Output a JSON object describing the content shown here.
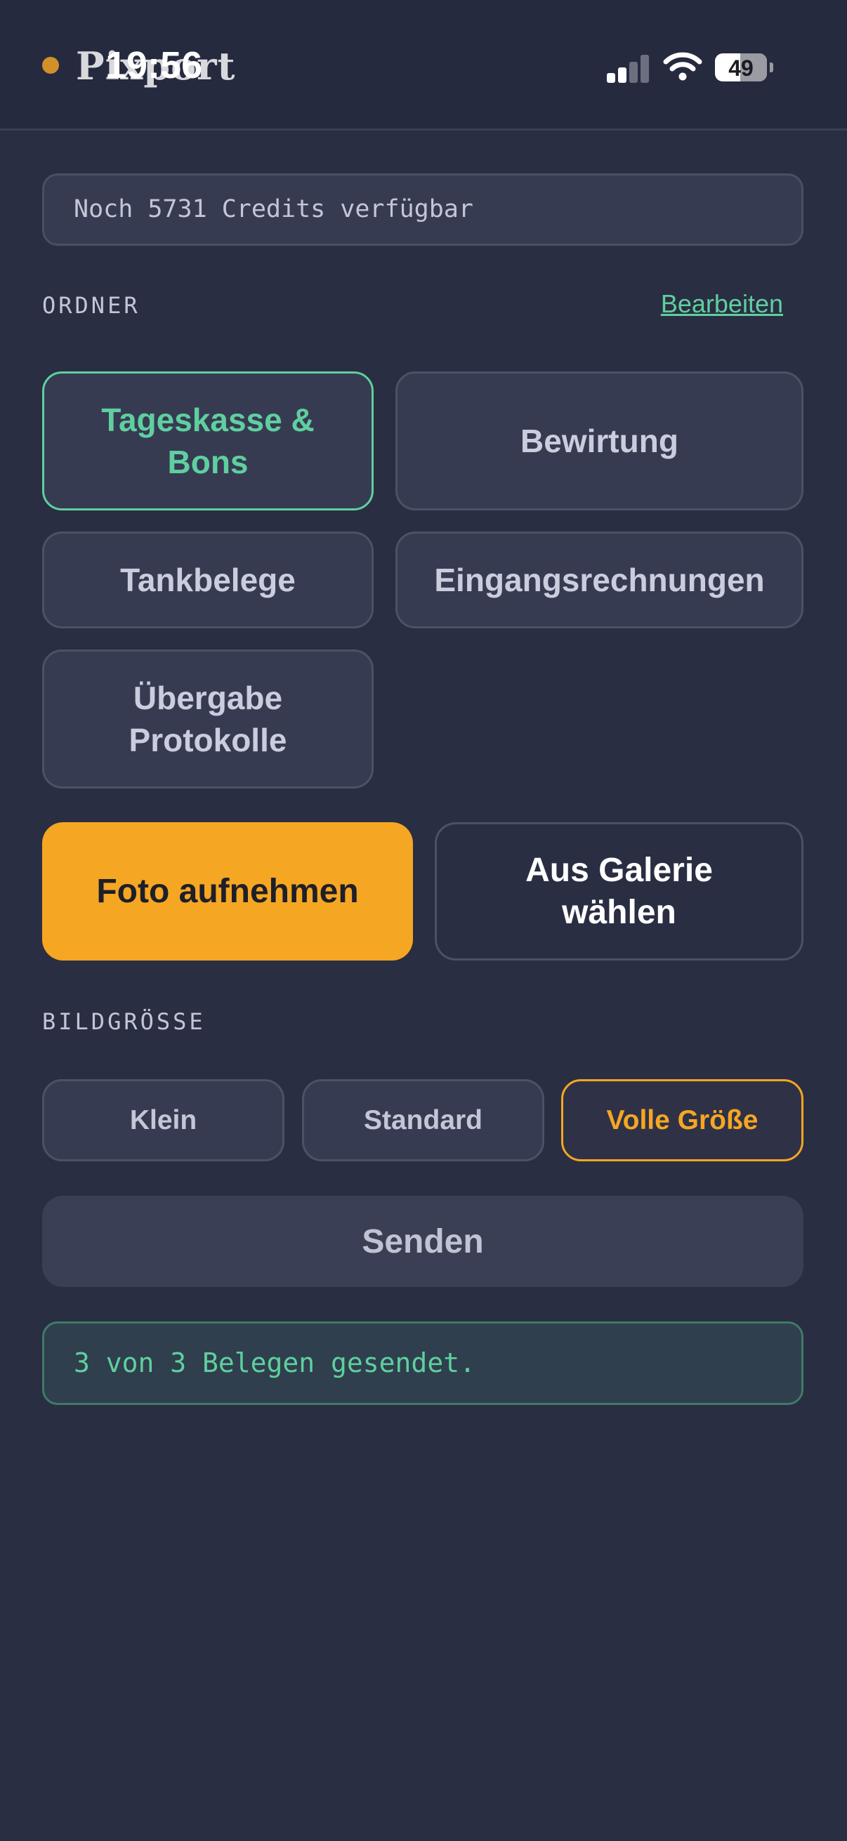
{
  "status_bar": {
    "time": "19:56",
    "battery": "49",
    "battery_level": 0.49,
    "signal_bars": 2
  },
  "header": {
    "app_name": "Pixport"
  },
  "credits": {
    "text": "Noch 5731 Credits verfügbar"
  },
  "folders": {
    "label": "ORDNER",
    "edit_label": "Bearbeiten",
    "items": [
      {
        "label": "Tageskasse & Bons",
        "active": true
      },
      {
        "label": "Bewirtung",
        "active": false
      },
      {
        "label": "Tankbelege",
        "active": false
      },
      {
        "label": "Eingangsrechnungen",
        "active": false
      },
      {
        "label": "Übergabe Protokolle",
        "active": false
      }
    ]
  },
  "actions": {
    "camera_label": "Foto aufnehmen",
    "gallery_label": "Aus Galerie wählen"
  },
  "image_size": {
    "label": "BILDGRÖSSE",
    "options": [
      {
        "label": "Klein",
        "active": false
      },
      {
        "label": "Standard",
        "active": false
      },
      {
        "label": "Volle Größe",
        "active": true
      }
    ]
  },
  "send": {
    "label": "Senden"
  },
  "status": {
    "message": "3 von 3 Belegen gesendet."
  },
  "colors": {
    "background": "#2a2e42",
    "accent_green": "#5fcf9f",
    "accent_orange": "#f5a623"
  }
}
